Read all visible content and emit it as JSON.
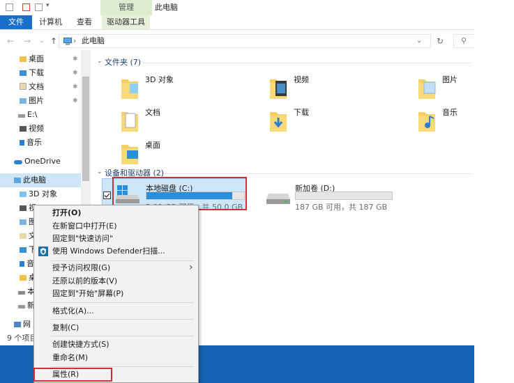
{
  "window": {
    "title": "此电脑",
    "manage_tab": "管理"
  },
  "ribbon": {
    "tabs": [
      "文件",
      "计算机",
      "查看",
      "驱动器工具"
    ]
  },
  "nav": {
    "back": "←",
    "forward": "→",
    "recent": "⌄",
    "up": "↑",
    "address": "此电脑",
    "address_sep": "›",
    "dropdown": "⌄",
    "refresh": "↻",
    "search_icon": "⚲"
  },
  "sidebar": {
    "items": [
      {
        "label": "桌面",
        "pinned": true
      },
      {
        "label": "下载",
        "pinned": true
      },
      {
        "label": "文档",
        "pinned": true
      },
      {
        "label": "图片",
        "pinned": true
      },
      {
        "label": "E:\\",
        "pinned": false
      },
      {
        "label": "视频",
        "pinned": false
      },
      {
        "label": "音乐",
        "pinned": false
      },
      {
        "label": "OneDrive",
        "pinned": false
      },
      {
        "label": "此电脑",
        "pinned": false
      },
      {
        "label": "3D 对象",
        "pinned": false
      },
      {
        "label": "视",
        "pinned": false
      },
      {
        "label": "图",
        "pinned": false
      },
      {
        "label": "文",
        "pinned": false
      },
      {
        "label": "下",
        "pinned": false
      },
      {
        "label": "音",
        "pinned": false
      },
      {
        "label": "桌",
        "pinned": false
      },
      {
        "label": "本",
        "pinned": false
      },
      {
        "label": "新",
        "pinned": false
      },
      {
        "label": "网",
        "pinned": false
      }
    ]
  },
  "folders_section": {
    "title": "文件夹 (7)",
    "items": [
      "3D 对象",
      "视频",
      "图片",
      "文档",
      "下载",
      "音乐",
      "桌面"
    ]
  },
  "drives_section": {
    "title": "设备和驱动器 (2)",
    "drives": [
      {
        "name": "本地磁盘 (C:)",
        "info": "5.91 GB 可用，共 50.0 GB",
        "used_fraction": 0.88
      },
      {
        "name": "新加卷 (D:)",
        "info": "187 GB 可用，共 187 GB",
        "used_fraction": 0.0
      }
    ]
  },
  "status": {
    "item_count": "9 个项目"
  },
  "context_menu": {
    "items": [
      "打开(O)",
      "在新窗口中打开(E)",
      "固定到\"快速访问\"",
      "使用 Windows Defender扫描...",
      "授予访问权限(G)",
      "还原以前的版本(V)",
      "固定到\"开始\"屏幕(P)",
      "格式化(A)...",
      "复制(C)",
      "创建快捷方式(S)",
      "重命名(M)",
      "属性(R)"
    ],
    "submenu_arrow": "›",
    "highlight_color": "#c8323a"
  },
  "colors": {
    "accent": "#1a6fc9",
    "manage_tab_bg": "#dbeccf",
    "selection": "#cfe6f7",
    "progress": "#2a8fd8",
    "highlight_box": "#c8323a"
  }
}
